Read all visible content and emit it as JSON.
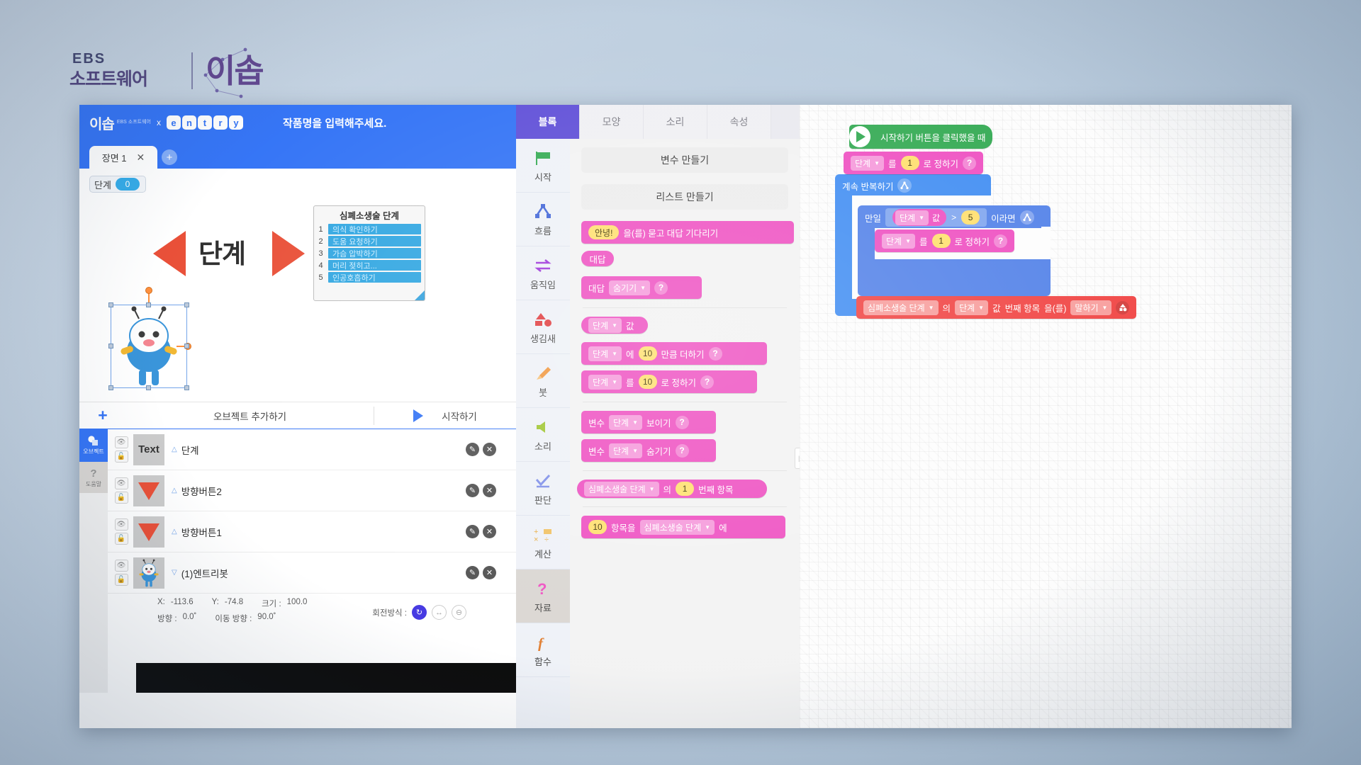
{
  "brand": {
    "ebs": "EBS",
    "sw": "소프트웨어",
    "logo": "이솝"
  },
  "topbar": {
    "logo": "이솝",
    "sub": "EBS 소프트웨어",
    "x": "x",
    "entry_letters": [
      "e",
      "n",
      "t",
      "r",
      "y"
    ],
    "project_title": "작품명을 입력해주세요."
  },
  "scenebar": {
    "tab_label": "장면 1",
    "close_icon": "✕",
    "add_icon": "+"
  },
  "stage": {
    "variable_monitor": {
      "name": "단계",
      "value": "0"
    },
    "title_text": "단계",
    "left_arrow_name": "방향버튼1",
    "right_arrow_name": "방향버튼2",
    "list_widget": {
      "title": "심폐소생술 단계",
      "items": [
        {
          "index": "1",
          "text": "의식 확인하기"
        },
        {
          "index": "2",
          "text": "도움 요청하기"
        },
        {
          "index": "3",
          "text": "가슴 압박하기"
        },
        {
          "index": "4",
          "text": "머리 젖히고..."
        },
        {
          "index": "5",
          "text": "인공호흡하기"
        }
      ]
    }
  },
  "object_header": {
    "plus": "+",
    "add_label": "오브젝트 추가하기",
    "run_label": "시작하기"
  },
  "object_side": {
    "object_tab": "오브젝트",
    "help_tab": "도움말",
    "help_icon": "?"
  },
  "objects": [
    {
      "name": "단계",
      "thumb_kind": "text",
      "thumb_text": "Text",
      "caret": "△",
      "eye": "👁",
      "lock": "🔓",
      "edit": "✎",
      "delete": "✕"
    },
    {
      "name": "방향버튼2",
      "thumb_kind": "tri-down",
      "thumb_text": "",
      "caret": "△",
      "eye": "👁",
      "lock": "🔓",
      "edit": "✎",
      "delete": "✕"
    },
    {
      "name": "방향버튼1",
      "thumb_kind": "tri-down",
      "thumb_text": "",
      "caret": "△",
      "eye": "👁",
      "lock": "🔓",
      "edit": "✎",
      "delete": "✕"
    },
    {
      "name": "(1)엔트리봇",
      "thumb_kind": "bot",
      "thumb_text": "",
      "caret": "▽",
      "eye": "👁",
      "lock": "🔓",
      "edit": "✎",
      "delete": "✕"
    }
  ],
  "properties": {
    "x_label": "X:",
    "x_value": "-113.6",
    "y_label": "Y:",
    "y_value": "-74.8",
    "size_label": "크기 :",
    "size_value": "100.0",
    "dir_label": "방향 :",
    "dir_value": "0.0˚",
    "move_dir_label": "이동 방향 :",
    "move_dir_value": "90.0˚",
    "rotation_label": "회전방식 :",
    "rot_free": "↻",
    "rot_lr": "↔",
    "rot_none": "⊖"
  },
  "tabs": [
    {
      "label": "블록",
      "active": true
    },
    {
      "label": "모양",
      "active": false
    },
    {
      "label": "소리",
      "active": false
    },
    {
      "label": "속성",
      "active": false
    }
  ],
  "categories": [
    {
      "label": "시작",
      "icon": "⚑",
      "color": "#2fa84f",
      "active": false
    },
    {
      "label": "흐름",
      "icon": "⋏",
      "color": "#3d62d6",
      "active": false
    },
    {
      "label": "움직임",
      "icon": "⇄",
      "color": "#9b30d9",
      "active": false
    },
    {
      "label": "생김새",
      "icon": "◣",
      "color": "#e0383a",
      "active": false
    },
    {
      "label": "붓",
      "icon": "🖌",
      "color": "#f0943a",
      "active": false
    },
    {
      "label": "소리",
      "icon": "🔊",
      "color": "#9cc42a",
      "active": false
    },
    {
      "label": "판단",
      "icon": "✓",
      "color": "#7b8ce8",
      "active": false
    },
    {
      "label": "계산",
      "icon": "✛",
      "color": "#e8a93a",
      "active": false
    },
    {
      "label": "자료",
      "icon": "?",
      "color": "#ee4cc0",
      "active": true
    },
    {
      "label": "함수",
      "icon": "ƒ",
      "color": "#e07a2a",
      "active": false
    }
  ],
  "palette": {
    "make_variable": "변수 만들기",
    "make_list": "리스트 만들기",
    "blocks": [
      {
        "name": "ask-and-wait",
        "parts": [
          {
            "t": "field",
            "v": "안녕!"
          },
          {
            "t": "text",
            "v": "을(를) 묻고 대답 기다리기"
          }
        ]
      },
      {
        "name": "answer-value",
        "parts": [
          {
            "t": "text",
            "v": "대답"
          }
        ]
      },
      {
        "name": "answer-visibility",
        "parts": [
          {
            "t": "text",
            "v": "대답"
          },
          {
            "t": "dd",
            "v": "숨기기"
          },
          {
            "t": "qm",
            "v": "?"
          }
        ]
      },
      {
        "name": "variable-value",
        "parts": [
          {
            "t": "dd",
            "v": "단계"
          },
          {
            "t": "text",
            "v": "값"
          }
        ]
      },
      {
        "name": "change-variable-by",
        "parts": [
          {
            "t": "dd",
            "v": "단계"
          },
          {
            "t": "text",
            "v": "에"
          },
          {
            "t": "num",
            "v": "10"
          },
          {
            "t": "text",
            "v": "만큼 더하기"
          },
          {
            "t": "qm",
            "v": "?"
          }
        ]
      },
      {
        "name": "set-variable-to",
        "parts": [
          {
            "t": "dd",
            "v": "단계"
          },
          {
            "t": "text",
            "v": "를"
          },
          {
            "t": "num",
            "v": "10"
          },
          {
            "t": "text",
            "v": "로 정하기"
          },
          {
            "t": "qm",
            "v": "?"
          }
        ]
      },
      {
        "name": "show-variable",
        "parts": [
          {
            "t": "text",
            "v": "변수"
          },
          {
            "t": "dd",
            "v": "단계"
          },
          {
            "t": "text",
            "v": "보이기"
          },
          {
            "t": "qm",
            "v": "?"
          }
        ]
      },
      {
        "name": "hide-variable",
        "parts": [
          {
            "t": "text",
            "v": "변수"
          },
          {
            "t": "dd",
            "v": "단계"
          },
          {
            "t": "text",
            "v": "숨기기"
          },
          {
            "t": "qm",
            "v": "?"
          }
        ]
      },
      {
        "name": "list-item-at",
        "parts": [
          {
            "t": "dd",
            "v": "심폐소생술 단계"
          },
          {
            "t": "text",
            "v": "의"
          },
          {
            "t": "num",
            "v": "1"
          },
          {
            "t": "text",
            "v": "번째 항목"
          }
        ]
      },
      {
        "name": "add-item-to-list",
        "parts": [
          {
            "t": "num",
            "v": "10"
          },
          {
            "t": "text",
            "v": "항목을"
          },
          {
            "t": "dd",
            "v": "심폐소생술 단계"
          },
          {
            "t": "text",
            "v": "에"
          }
        ]
      }
    ]
  },
  "script": {
    "hat": {
      "label": "시작하기 버튼을 클릭했을 때",
      "icon": "play-flag-icon"
    },
    "set_step_1": {
      "var": "단계",
      "mid": "를",
      "value": "1",
      "tail": "로 정하기",
      "qm": "?"
    },
    "repeat_forever": {
      "label": "계속 반복하기",
      "icon": "repeat-icon"
    },
    "if_block": {
      "prefix": "만일",
      "var": "단계",
      "var_suffix": "값",
      "operator": ">",
      "compare": "5",
      "suffix": "이라면",
      "icon": "flow-icon"
    },
    "set_step_inner": {
      "var": "단계",
      "mid": "를",
      "value": "1",
      "tail": "로 정하기",
      "qm": "?"
    },
    "say_block": {
      "list": "심폐소생술 단계",
      "of": "의",
      "idx_var": "단계",
      "idx_suffix": "값",
      "nth": "번째 항목",
      "particle": "을(를)",
      "action": "말하기",
      "icon": "looks-icon"
    }
  },
  "canvas": {
    "move_cursor_icon": "✥"
  }
}
